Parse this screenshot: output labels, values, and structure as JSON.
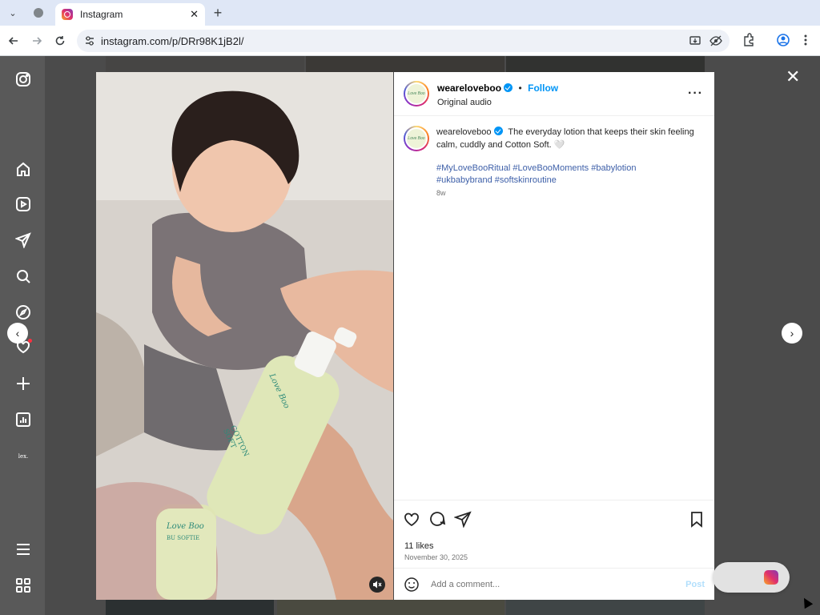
{
  "browser": {
    "tab_title": "Instagram",
    "url": "instagram.com/p/DRr98K1jB2l/",
    "tab_close": "✕",
    "new_tab": "+"
  },
  "sidebar": {
    "icons": [
      "instagram-icon",
      "home-icon",
      "reels-icon",
      "messages-icon",
      "search-icon",
      "explore-icon",
      "notifications-icon",
      "create-icon",
      "dashboard-icon",
      "profile-icon",
      "menu-icon",
      "more-icon"
    ],
    "profile_label": "lex."
  },
  "post": {
    "username": "weareloveboo",
    "follow_label": "Follow",
    "separator": "•",
    "audio": "Original audio",
    "avatar_text": "Love Boo",
    "caption_user": "weareloveboo",
    "caption_text": "The everyday lotion that keeps their skin feeling calm, cuddly and Cotton Soft. 🤍",
    "hashtags_line1": "#MyLoveBooRitual #LoveBooMoments #babylotion",
    "hashtags_line2": "#ukbabybrand #softskinroutine",
    "age": "8w",
    "likes": "11 likes",
    "date": "November 30, 2025",
    "comment_placeholder": "Add a comment...",
    "post_label": "Post",
    "more_label": "···"
  },
  "product": {
    "brand": "Love Boo",
    "bottle_text": "COTTON SOFT",
    "tube_text": "BU SOFTIE"
  },
  "close_label": "✕",
  "prev_label": "‹",
  "next_label": "›",
  "colors": {
    "link_blue": "#0095f6",
    "hashtag": "#3d5fa8",
    "overlay": "rgba(0,0,0,0.65)"
  }
}
